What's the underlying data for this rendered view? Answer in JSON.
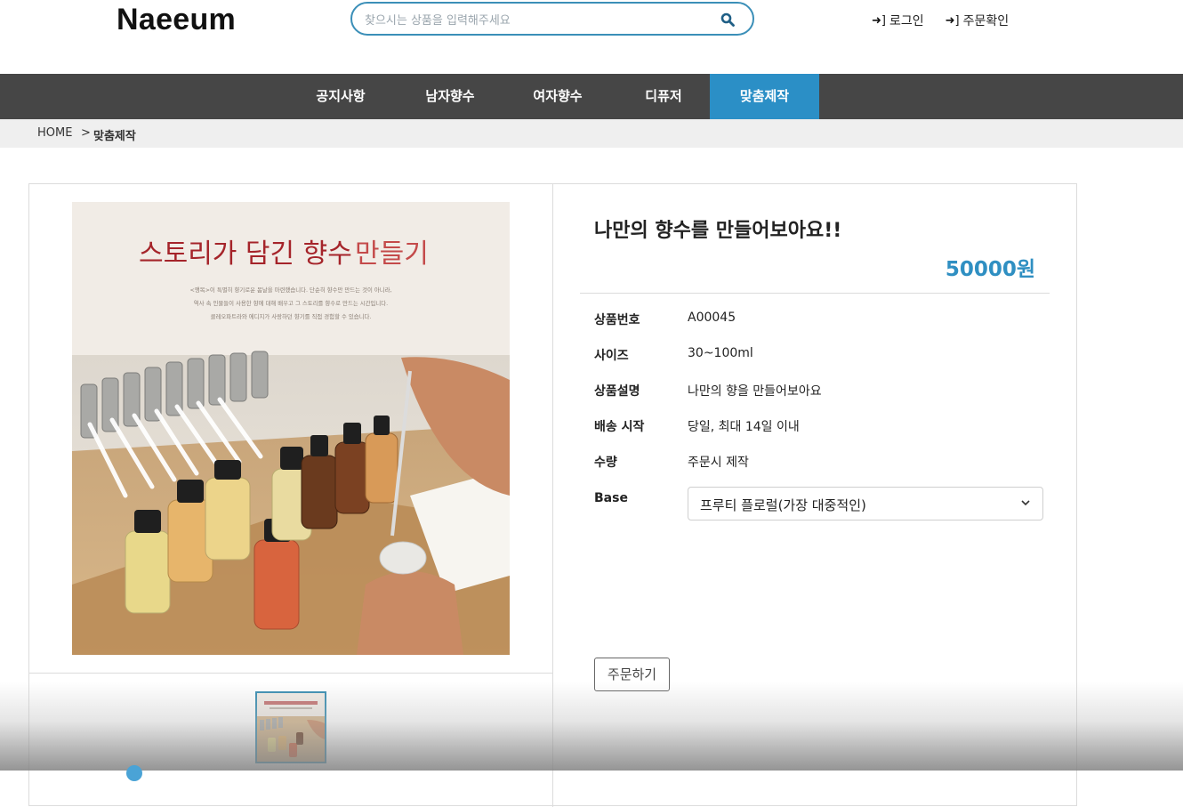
{
  "header": {
    "logo": "Naeeum",
    "search_placeholder": "찾으시는 상품을 입력해주세요",
    "login": "로그인",
    "order_check": "주문확인"
  },
  "nav": {
    "items": [
      "공지사항",
      "남자향수",
      "여자향수",
      "디퓨저",
      "맞춤제작"
    ],
    "active": "맞춤제작"
  },
  "breadcrumb": {
    "home": "HOME",
    "sep": ">",
    "current": "맞춤제작"
  },
  "image": {
    "title_a": "스토리가 담긴 향수",
    "title_b": "만들기",
    "desc_1": "<행복>이 특별히 향기로운 봄날을 마련했습니다. 단순히 향수만 만드는 것이 아니라,",
    "desc_2": "역사 속 인물들이 사용한 향에 대해 배우고 그 스토리를 향수로 만드는 시간입니다.",
    "desc_3": "클레오파트라와 에디지가 사랑하던 향기를 직접 경험할 수 있습니다."
  },
  "product": {
    "title": "나만의 향수를 만들어보아요!!",
    "price": "50000원",
    "rows": [
      {
        "label": "상품번호",
        "value": "A00045"
      },
      {
        "label": "사이즈",
        "value": "30~100ml"
      },
      {
        "label": "상품설명",
        "value": "나만의 향을 만들어보아요"
      },
      {
        "label": "배송 시작",
        "value": "당일, 최대 14일 이내"
      },
      {
        "label": "수량",
        "value": "주문시 제작"
      }
    ],
    "base_label": "Base",
    "base_selected": "프루티 플로럴(가장 대중적인)",
    "order_button": "주문하기"
  },
  "colors": {
    "accent": "#2b8fc6",
    "nav_bg": "#464646",
    "price": "#2f8fc2"
  }
}
